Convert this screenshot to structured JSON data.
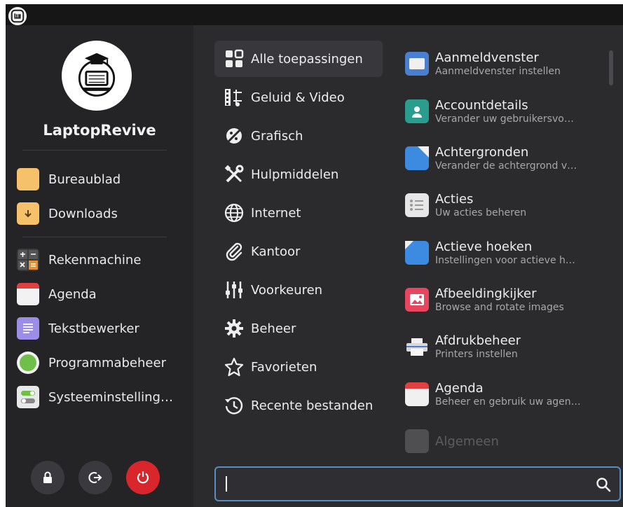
{
  "user": {
    "name": "LaptopRevive"
  },
  "places": [
    {
      "label": "Bureaublad",
      "icon": "folder-icon"
    },
    {
      "label": "Downloads",
      "icon": "downloads-folder-icon"
    }
  ],
  "favorites": [
    {
      "label": "Rekenmachine",
      "icon": "calculator-icon"
    },
    {
      "label": "Agenda",
      "icon": "calendar-icon"
    },
    {
      "label": "Tekstbewerker",
      "icon": "text-editor-icon"
    },
    {
      "label": "Programmabeheer",
      "icon": "software-manager-icon"
    },
    {
      "label": "Systeeminstelling…",
      "icon": "system-settings-icon"
    }
  ],
  "session_buttons": [
    {
      "icon": "lock-icon"
    },
    {
      "icon": "logout-icon"
    },
    {
      "icon": "power-icon"
    }
  ],
  "categories": [
    {
      "label": "Alle toepassingen",
      "icon": "grid-icon",
      "active": true
    },
    {
      "label": "Geluid & Video",
      "icon": "film-icon"
    },
    {
      "label": "Grafisch",
      "icon": "graphics-icon"
    },
    {
      "label": "Hulpmiddelen",
      "icon": "tools-icon"
    },
    {
      "label": "Internet",
      "icon": "globe-icon"
    },
    {
      "label": "Kantoor",
      "icon": "paperclip-icon"
    },
    {
      "label": "Voorkeuren",
      "icon": "sliders-icon"
    },
    {
      "label": "Beheer",
      "icon": "gear-icon"
    },
    {
      "label": "Favorieten",
      "icon": "star-icon"
    },
    {
      "label": "Recente bestanden",
      "icon": "history-icon"
    }
  ],
  "apps": [
    {
      "name": "Aanmeldvenster",
      "desc": "Aanmeldvenster instellen",
      "icon": "login-window-icon"
    },
    {
      "name": "Accountdetails",
      "desc": "Verander uw gebruikersvo…",
      "icon": "account-icon"
    },
    {
      "name": "Achtergronden",
      "desc": "Verander de achtergrond v…",
      "icon": "backgrounds-icon"
    },
    {
      "name": "Acties",
      "desc": "Uw acties beheren",
      "icon": "actions-icon"
    },
    {
      "name": "Actieve hoeken",
      "desc": "Instellingen voor actieve h…",
      "icon": "hot-corners-icon"
    },
    {
      "name": "Afbeeldingkijker",
      "desc": "Browse and rotate images",
      "icon": "image-viewer-icon"
    },
    {
      "name": "Afdrukbeheer",
      "desc": "Printers instellen",
      "icon": "printer-icon"
    },
    {
      "name": "Agenda",
      "desc": "Beheer en gebruik uw agen…",
      "icon": "calendar-icon"
    },
    {
      "name": "Algemeen",
      "desc": "",
      "icon": "general-settings-icon"
    }
  ],
  "search": {
    "value": "",
    "placeholder": ""
  },
  "colors": {
    "sidebar": "#242427",
    "panel": "#2b2b2e",
    "accent": "#5b8dbf",
    "power": "#d9262c"
  }
}
